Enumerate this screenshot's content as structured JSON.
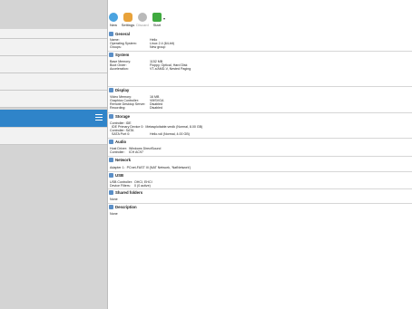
{
  "toolbar": {
    "buttons": [
      {
        "label": "New",
        "icon": "new-icon"
      },
      {
        "label": "Settings",
        "icon": "gear-icon"
      },
      {
        "label": "Discard",
        "icon": "discard-icon"
      },
      {
        "label": "Start",
        "icon": "start-arrow-icon"
      }
    ]
  },
  "sections": {
    "general": {
      "title": "General",
      "rows": [
        {
          "k": "Name:",
          "v": "Hello"
        },
        {
          "k": "Operating System:",
          "v": "Linux 2.4 (64-bit)"
        },
        {
          "k": "Groups:",
          "v": "New group"
        }
      ]
    },
    "system": {
      "title": "System",
      "rows": [
        {
          "k": "Base Memory:",
          "v": "1152 MB"
        },
        {
          "k": "Boot Order:",
          "v": "Floppy, Optical, Hard Disk"
        },
        {
          "k": "Acceleration:",
          "v": "VT-x/AMD-V, Nested Paging"
        }
      ]
    },
    "display": {
      "title": "Display",
      "rows": [
        {
          "k": "Video Memory:",
          "v": "16 MB"
        },
        {
          "k": "Graphics Controller:",
          "v": "VMSVGA"
        },
        {
          "k": "Remote Desktop Server:",
          "v": "Disabled"
        },
        {
          "k": "Recording:",
          "v": "Disabled"
        }
      ]
    },
    "storage": {
      "title": "Storage",
      "rows": [
        {
          "text": "Controller: IDE"
        },
        {
          "text": "  IDE Primary Device 0:  Metasploitable.vmdk (Normal, 8.00 GB)"
        },
        {
          "text": "Controller: SATA"
        },
        {
          "text": "  SATA Port 0:",
          "v": "Hello.vdi (Normal, 4.00 GB)"
        }
      ]
    },
    "audio": {
      "title": "Audio",
      "rows": [
        {
          "k": "Host Driver:",
          "v": "Windows DirectSound"
        },
        {
          "k": "Controller:",
          "v": "ICH AC97"
        }
      ]
    },
    "network": {
      "title": "Network",
      "rows": [
        {
          "text": "Adapter 1:  PCnet-FAST III (NAT Network, 'NatNetwork')"
        }
      ]
    },
    "usb": {
      "title": "USB",
      "rows": [
        {
          "k": "USB Controller:",
          "v": "OHCI, EHCI"
        },
        {
          "k": "Device Filters:",
          "v": "0 (0 active)"
        }
      ]
    },
    "shared": {
      "title": "Shared folders",
      "rows": [
        {
          "text": "None"
        }
      ]
    },
    "description": {
      "title": "Description",
      "rows": [
        {
          "text": "None"
        }
      ]
    }
  },
  "colors": {
    "selection": "#2f84c9",
    "section_icon": "#5b8fc7",
    "new_icon": "#4aa3e0",
    "settings_icon": "#e8a23a",
    "discard_icon": "#b9b9b9",
    "start_icon": "#3faa3f"
  }
}
